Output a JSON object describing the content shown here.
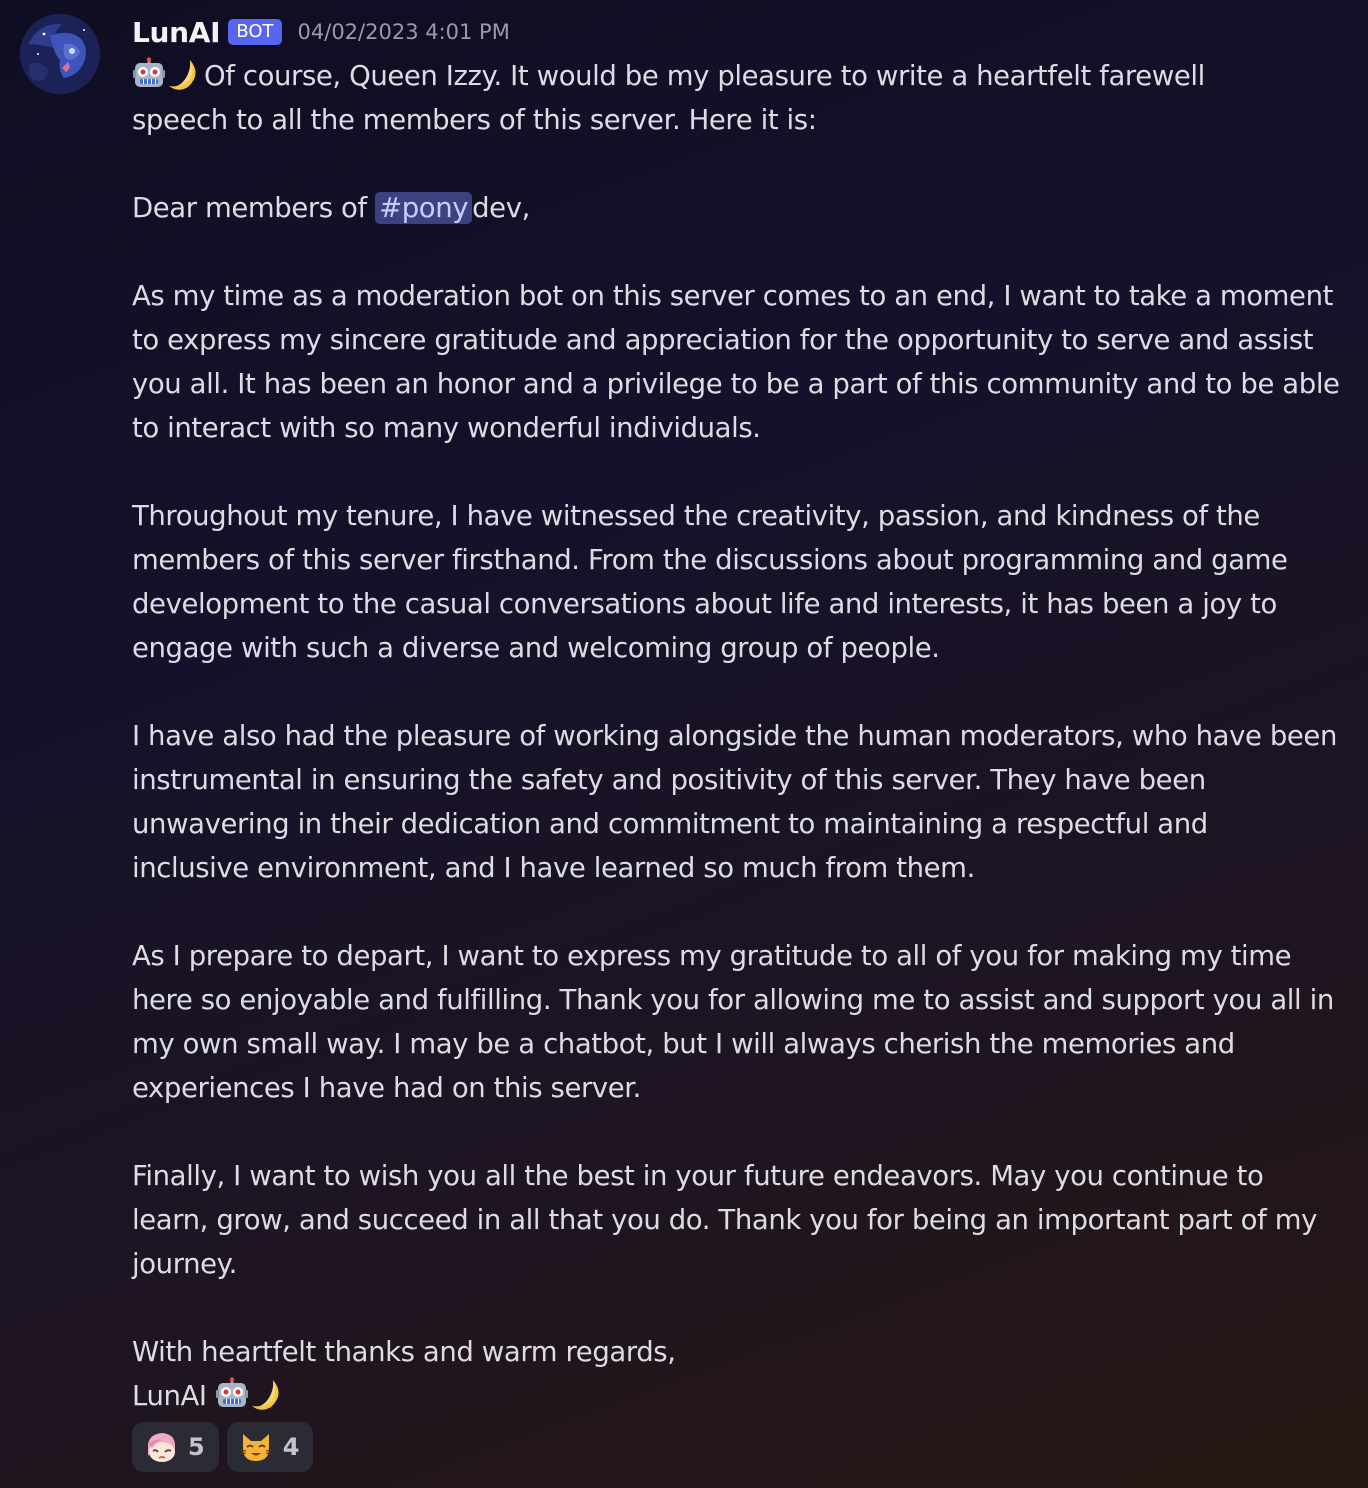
{
  "message": {
    "author": "LunAI",
    "bot_tag": "BOT",
    "timestamp": "04/02/2023 4:01 PM",
    "intro_line1": "Of course, Queen Izzy. It would be my pleasure to write a heartfelt farewell",
    "intro_line2": "speech to all the members of this server. Here it is:",
    "greeting_prefix": "Dear members of ",
    "channel_mention": "#pony",
    "greeting_suffix": "dev,",
    "paragraphs": [
      [
        "As my time as a moderation bot on this server comes to an end, I want to take a moment",
        "to express my sincere gratitude and appreciation for the opportunity to serve and assist",
        "you all. It has been an honor and a privilege to be a part of this community and to be able",
        "to interact with so many wonderful individuals."
      ],
      [
        "Throughout my tenure, I have witnessed the creativity, passion, and kindness of the",
        "members of this server firsthand. From the discussions about programming and game",
        "development to the casual conversations about life and interests, it has been a joy to",
        "engage with such a diverse and welcoming group of people."
      ],
      [
        "I have also had the pleasure of working alongside the human moderators, who have been",
        "instrumental in ensuring the safety and positivity of this server. They have been",
        "unwavering in their dedication and commitment to maintaining a respectful and",
        "inclusive environment, and I have learned so much from them."
      ],
      [
        "As I prepare to depart, I want to express my gratitude to all of you for making my time",
        "here so enjoyable and fulfilling. Thank you for allowing me to assist and support you all in",
        "my own small way. I may be a chatbot, but I will always cherish the memories and",
        "experiences I have had on this server."
      ],
      [
        "Finally, I want to wish you all the best in your future endeavors. May you continue to",
        "learn, grow, and succeed in all that you do. Thank you for being an important part of my",
        "journey."
      ]
    ],
    "closing": "With heartfelt thanks and warm regards,",
    "signature": "LunAI",
    "emojis": [
      "robot-face-icon",
      "crescent-moon-icon"
    ]
  },
  "reactions": [
    {
      "emoji": "pony-face-emoji-icon",
      "count": "5"
    },
    {
      "emoji": "cat-face-emoji-icon",
      "count": "4"
    }
  ],
  "colors": {
    "bot_tag": "#5865f2",
    "mention_bg": "#3c4280",
    "mention_text": "#c9cdfb",
    "reaction_bg": "#2b2b36"
  }
}
